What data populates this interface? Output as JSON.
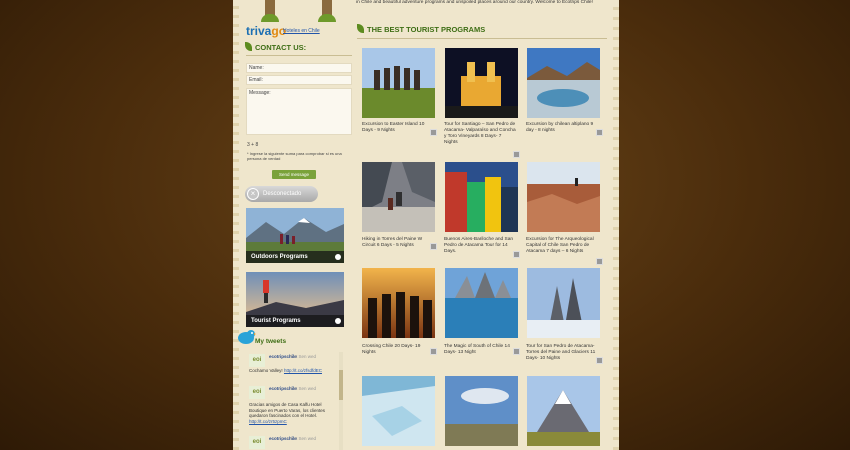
{
  "header": {
    "intro_text": "in Chile and beautiful adventure programs and unspoiled places around our country. Welcome to Ecotrips Chile!"
  },
  "trivago": {
    "logo_part1": "triva",
    "logo_part2": "go",
    "sub": "Hoteles en Chile"
  },
  "contact": {
    "title": "CONTACT US:",
    "name_label": "Name:",
    "email_label": "Email:",
    "message_label": "Message:",
    "captcha": "3 + 8",
    "captcha_hint": "* Ingrese la siguiente suma para comprobar si es una persona de verdad",
    "send_label": "Send message"
  },
  "chat": {
    "status_label": "Desconectado"
  },
  "banners": [
    {
      "label": "Outdoors Programs"
    },
    {
      "label": "Tourist Programs"
    }
  ],
  "tweets": {
    "title": "My tweets",
    "items": [
      {
        "user": "ecotripschile",
        "via": "hot Sen wed",
        "text": "Cochamo Valley!",
        "link": "http://t.co/zfsdfdEC"
      },
      {
        "user": "ecotripschile",
        "via": "hot Sen wed",
        "text": "Gracias amigos de Casa Kalfu Hotel Boutique en Puerto Varas, los clientes quedaron fascinados con el Hotel.",
        "link": "http://t.co/zr5zpmC"
      },
      {
        "user": "ecotripschile",
        "via": "hot Sen wed",
        "text": "",
        "link": ""
      }
    ]
  },
  "programs": {
    "title": "THE BEST TOURIST PROGRAMS",
    "items": [
      {
        "caption": "Excursion to Easter Island 10 Days - 9 Nights",
        "image": "easter-island"
      },
      {
        "caption": "Tour for Santiago – San Pedro de Atacama- Valparaíso and Concha y Toro Vineyards 8 Days- 7 Nights",
        "image": "santiago-night"
      },
      {
        "caption": "Excursion by chilean altiplano 9 day - 8 nights",
        "image": "altiplano-lagoon"
      },
      {
        "caption": "Hiking in Torres del Paine W Circuit 6 Days - 5 Nights",
        "image": "hikers-rocks"
      },
      {
        "caption": "Buenos Aires-Bariloche and San Pedro de Atacama Tour for 14 Days.",
        "image": "buenos-aires-street"
      },
      {
        "caption": "Excursion for The Arqueological Capital of Chile San Pedro de Atacama 7 days – 6 Nights",
        "image": "desert-valley"
      },
      {
        "caption": "Crossing Chile 20 Days- 19 Nights",
        "image": "moai-sunset"
      },
      {
        "caption": "The Magic of South of Chile 14 Days- 13 Night",
        "image": "torres-lake"
      },
      {
        "caption": "Tour for San Pedro de Atacama- Torres del Paine and Glaciers 11 Days- 10 Nights",
        "image": "torres-peaks"
      },
      {
        "caption": "",
        "image": "glacier"
      },
      {
        "caption": "",
        "image": "patagonia-plain"
      },
      {
        "caption": "",
        "image": "volcano"
      }
    ]
  },
  "colors": {
    "accent_green": "#3e6e15",
    "page_bg": "#efe6cc",
    "body_bg": "#4a2c0c"
  }
}
